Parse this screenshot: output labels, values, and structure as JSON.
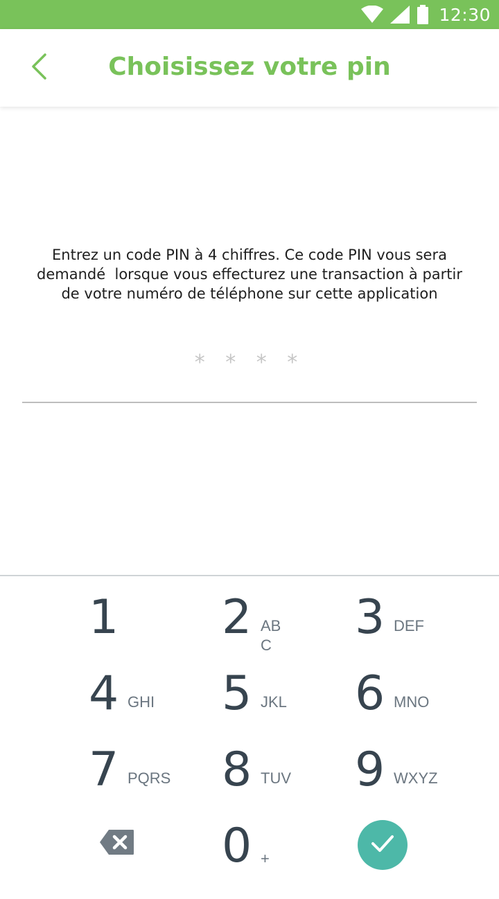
{
  "status_bar": {
    "time": "12:30",
    "wifi_icon": "wifi-icon",
    "signal_icon": "signal-icon",
    "battery_icon": "battery-icon"
  },
  "header": {
    "title": "Choisissez votre pin",
    "back_icon": "chevron-left-icon"
  },
  "instructions": {
    "line1": "Entrez un code PIN à 4 chiffres. Ce code PIN vous sera",
    "line2": "demandé  lorsque vous effecturez une transaction à partir",
    "line3": "de votre numéro de téléphone sur cette application"
  },
  "pin_input": {
    "placeholder": "* * * *",
    "value": ""
  },
  "keypad": {
    "keys": [
      {
        "digit": "1",
        "letters": ""
      },
      {
        "digit": "2",
        "letters": "ABC"
      },
      {
        "digit": "3",
        "letters": "DEF"
      },
      {
        "digit": "4",
        "letters": "GHI"
      },
      {
        "digit": "5",
        "letters": "JKL"
      },
      {
        "digit": "6",
        "letters": "MNO"
      },
      {
        "digit": "7",
        "letters": "PQRS"
      },
      {
        "digit": "8",
        "letters": "TUV"
      },
      {
        "digit": "9",
        "letters": "WXYZ"
      },
      {
        "digit": "0",
        "letters": "+"
      }
    ],
    "backspace_icon": "backspace-icon",
    "submit_icon": "checkmark-icon"
  },
  "colors": {
    "brand_green": "#79c25a",
    "accent_teal": "#4db8a8",
    "key_text": "#37444f",
    "key_letters": "#6b7680"
  }
}
